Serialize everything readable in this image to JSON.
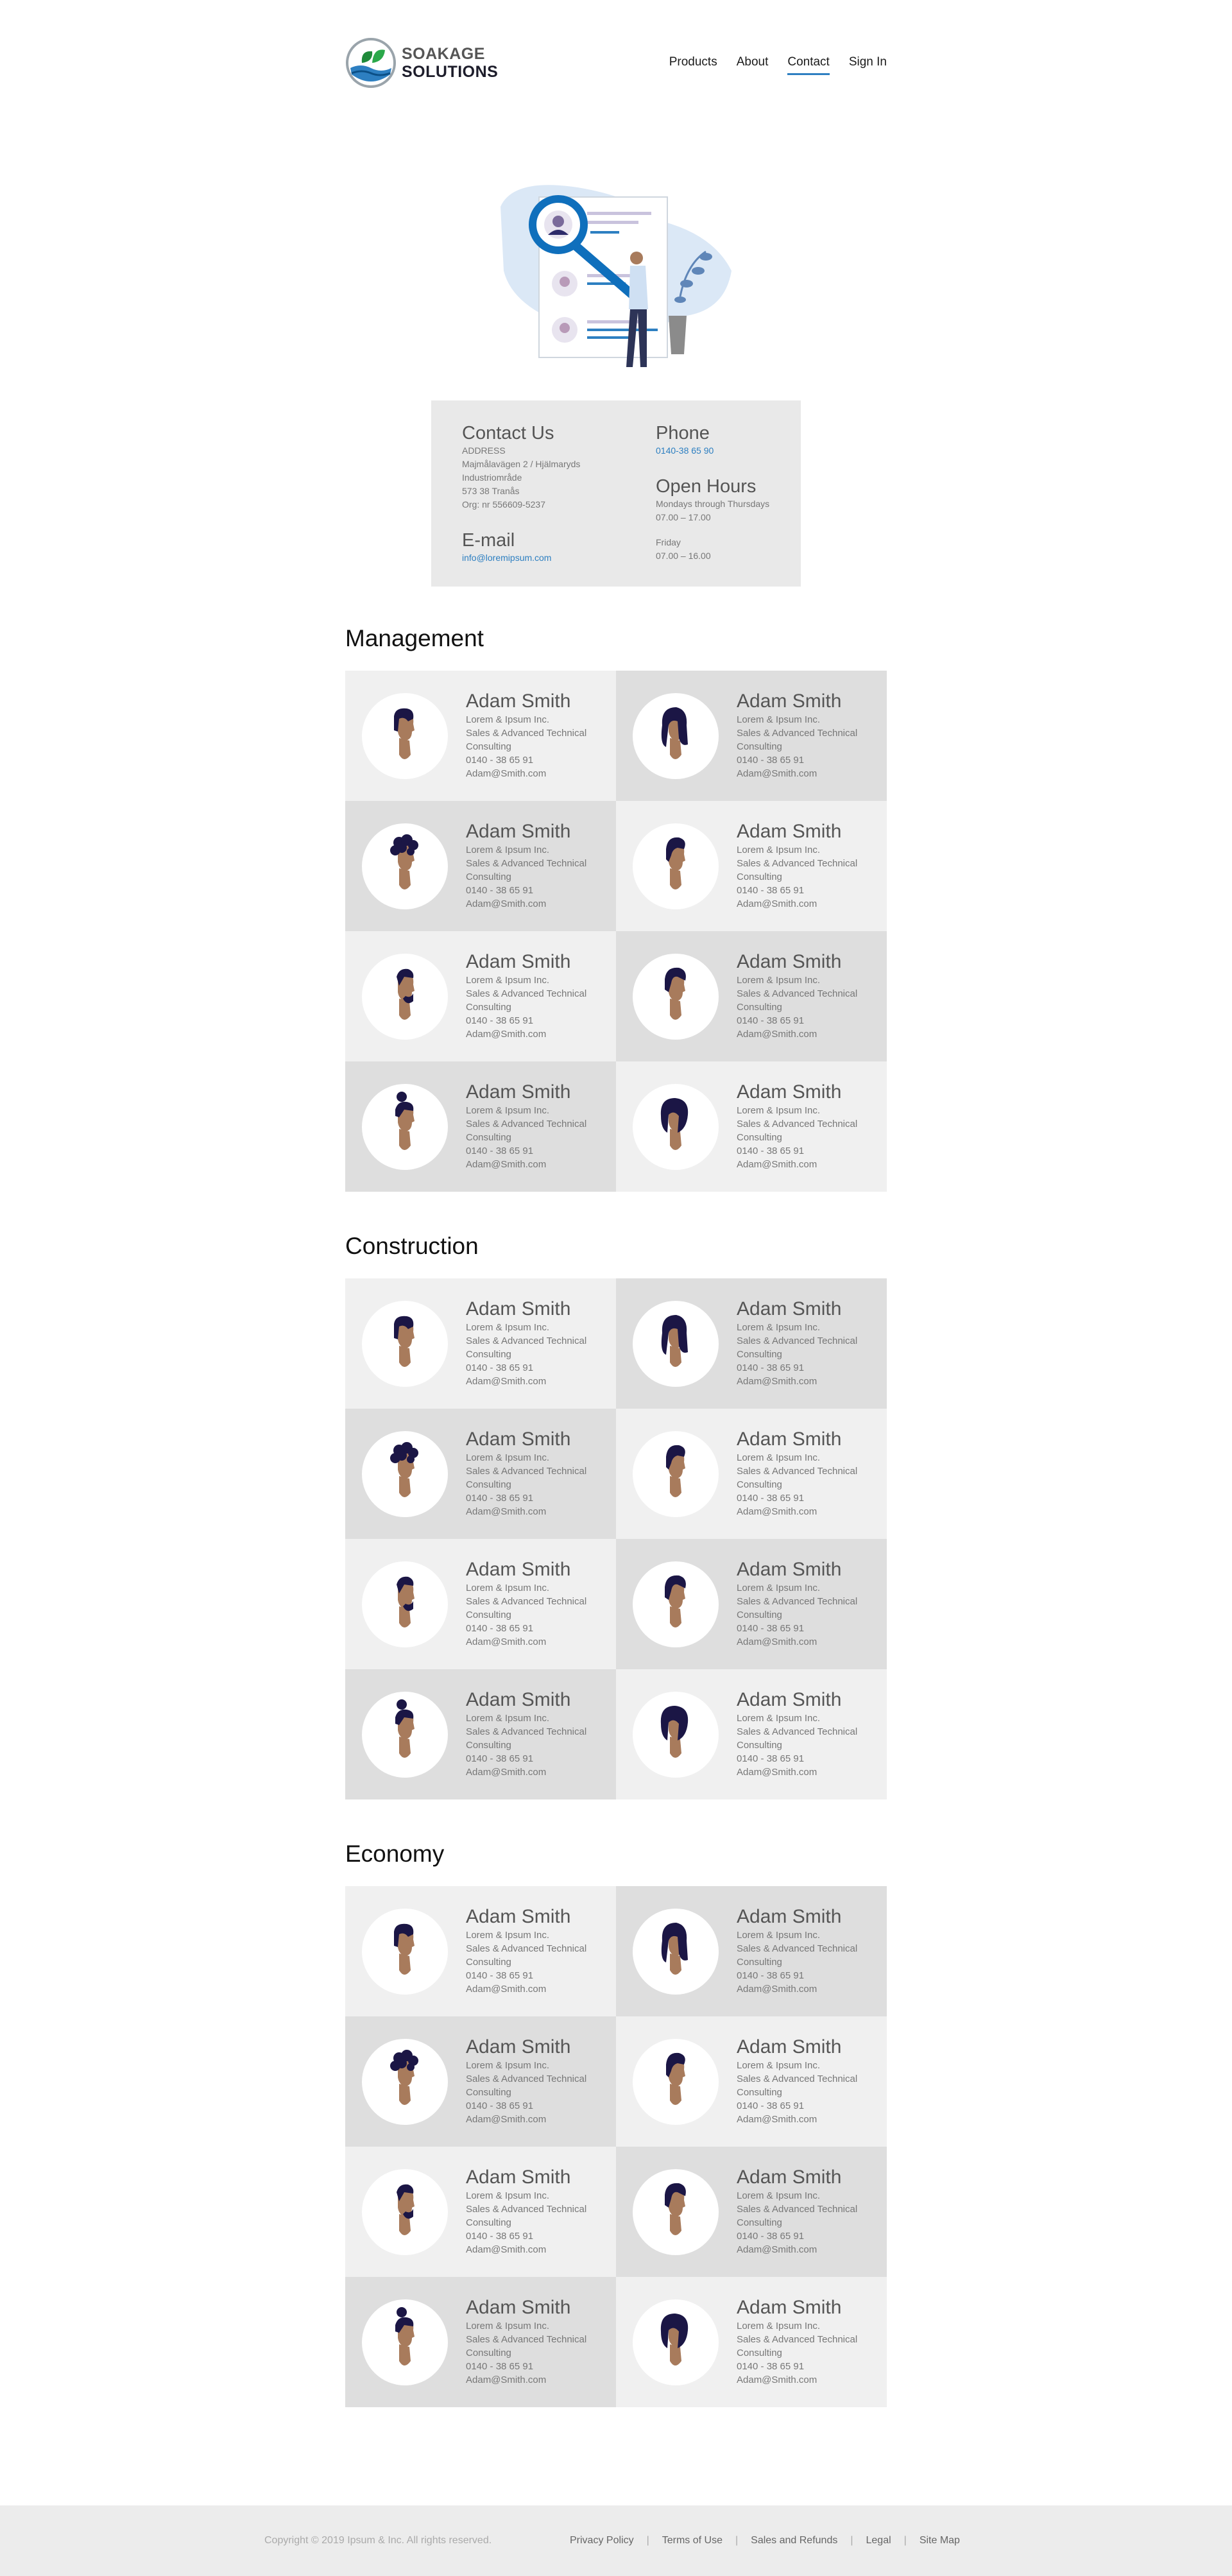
{
  "brand": {
    "line1": "SOAKAGE",
    "line2": "SOLUTIONS"
  },
  "nav": [
    {
      "label": "Products"
    },
    {
      "label": "About"
    },
    {
      "label": "Contact"
    },
    {
      "label": "Sign In"
    }
  ],
  "contact": {
    "title": "Contact Us",
    "address_label": "ADDRESS",
    "address_line1": "Majmålavägen 2 / Hjälmaryds",
    "address_line2": "Industriområde",
    "address_line3": "573 38 Tranås",
    "org": "Org: nr 556609-5237",
    "email_title": "E-mail",
    "email": "info@loremipsum.com",
    "phone_title": "Phone",
    "phone": "0140-38 65 90",
    "hours_title": "Open Hours",
    "hours_days1": "Mondays through Thursdays",
    "hours_time1": "07.00 – 17.00",
    "hours_days2": "Friday",
    "hours_time2": "07.00 – 16.00"
  },
  "person": {
    "name": "Adam Smith",
    "company": "Lorem & Ipsum Inc.",
    "role1": "Sales & Advanced Technical",
    "role2": "Consulting",
    "phone": "0140 - 38 65 91",
    "email": "Adam@Smith.com"
  },
  "sections": [
    {
      "title": "Management"
    },
    {
      "title": "Construction"
    },
    {
      "title": "Economy"
    }
  ],
  "footer": {
    "copyright": "Copyright © 2019 Ipsum & Inc. All rights reserved.",
    "links": [
      "Privacy Policy",
      "Terms of Use",
      "Sales and Refunds",
      "Legal",
      "Site Map"
    ]
  },
  "colors": {
    "accent": "#2d7fc1",
    "card_light": "#f0f0f0",
    "card_dark": "#dedede",
    "hair": "#1b1645",
    "skin": "#a87b5c"
  }
}
